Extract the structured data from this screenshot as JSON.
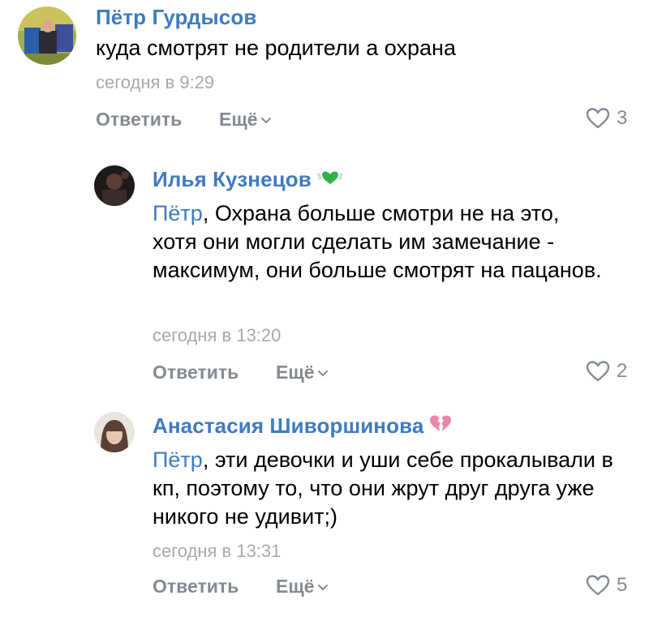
{
  "comments": [
    {
      "author": "Пётр Гурдысов",
      "mention": "",
      "text": "куда смотрят не родители а охрана",
      "time": "сегодня в 9:29",
      "reply_label": "Ответить",
      "more_label": "Ещё",
      "likes": "3",
      "badge": ""
    },
    {
      "author": "Илья Кузнецов",
      "mention": "Пётр",
      "text": ", Охрана больше смотри не на это, хотя они могли сделать им замечание - максимум, они больше смотрят на пацанов.",
      "time": "сегодня в 13:20",
      "reply_label": "Ответить",
      "more_label": "Ещё",
      "likes": "2",
      "badge": "green-winged-heart-icon"
    },
    {
      "author": "Анастасия Шиворшинова",
      "mention": "Пётр",
      "text": ", эти девочки и уши себе прокалывали в кп, поэтому то, что они жрут друг друга уже никого не удивит;)",
      "time": "сегодня в 13:31",
      "reply_label": "Ответить",
      "more_label": "Ещё",
      "likes": "5",
      "badge": "broken-heart-icon"
    }
  ],
  "colors": {
    "link": "#3f7bbf",
    "text": "#000000",
    "meta": "#a6a9ae",
    "action": "#848a92"
  }
}
